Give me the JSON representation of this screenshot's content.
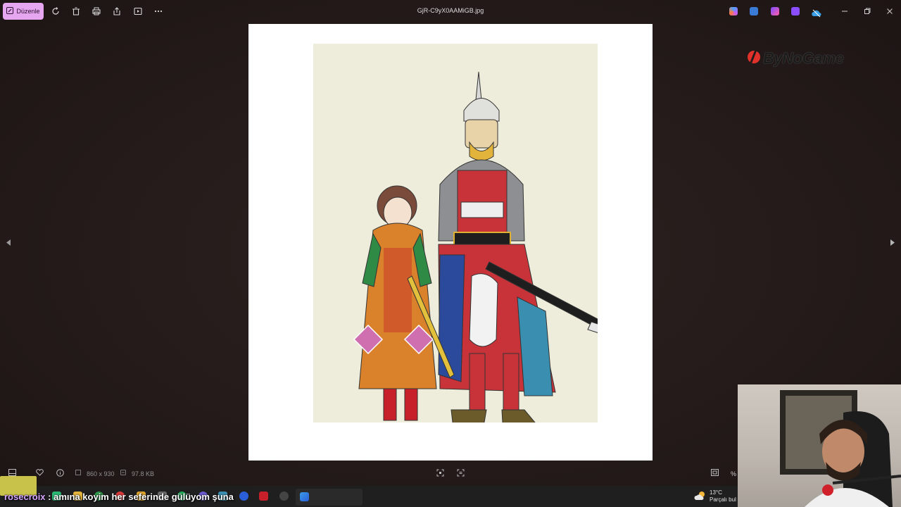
{
  "toolbar": {
    "edit_label": "Düzenle",
    "file_name": "GjR-C9yX0AAMiGB.jpg"
  },
  "image_info": {
    "dimensions": "860 x 930",
    "file_size": "97.8 KB",
    "zoom_label": "%"
  },
  "watermark": {
    "text": "ByNoGame"
  },
  "chat": {
    "user": "rosecroix",
    "message": ": amına koyim her seferinde gülüyom şuna"
  },
  "weather": {
    "temp": "13°C",
    "condition": "Parçalı bul"
  },
  "colors": {
    "accent": "#e7a7f0",
    "background": "#231a19",
    "art_background": "#eeecdb"
  }
}
